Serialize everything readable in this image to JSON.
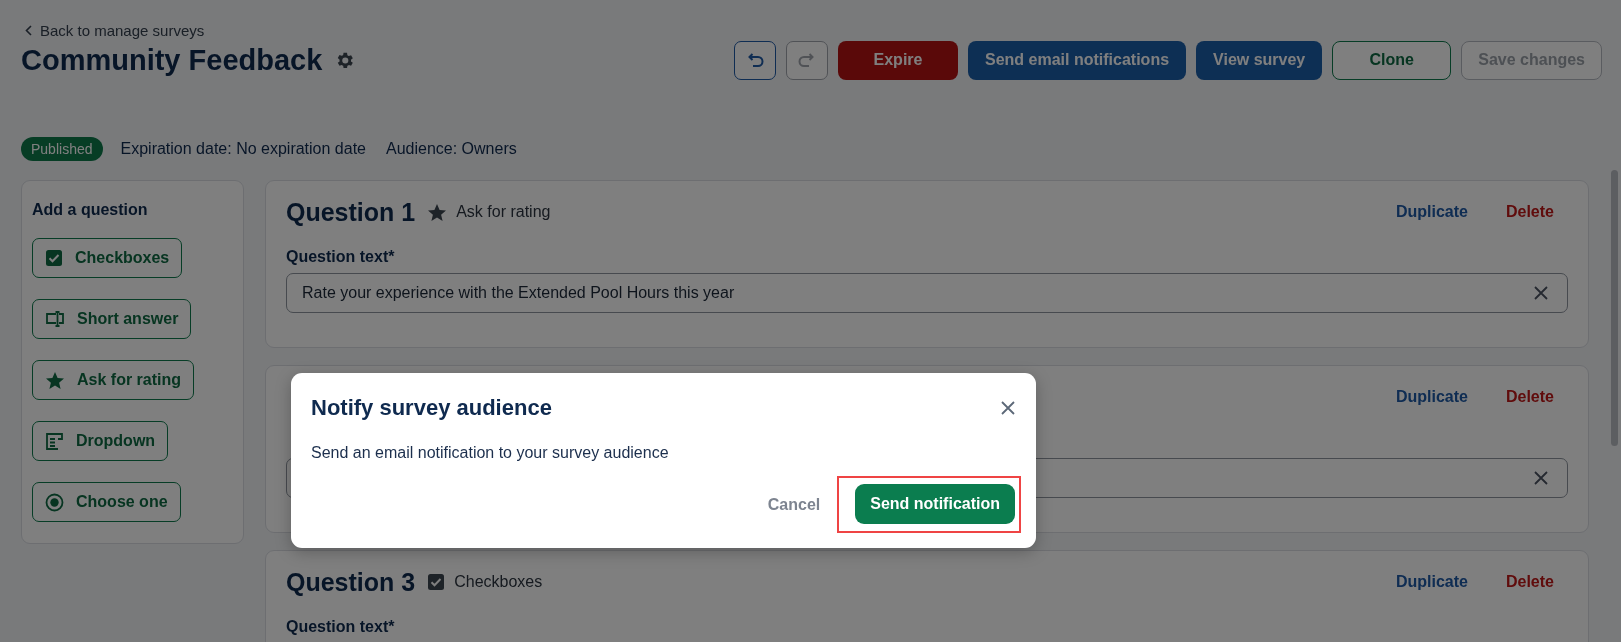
{
  "header": {
    "back_link": "Back to manage surveys",
    "title": "Community Feedback"
  },
  "toolbar": {
    "undo": {
      "disabled": false
    },
    "redo": {
      "disabled": true
    },
    "buttons": [
      {
        "label": "Expire",
        "kind": "danger",
        "disabled": false
      },
      {
        "label": "Send email notifications",
        "kind": "primary",
        "disabled": false
      },
      {
        "label": "View survey",
        "kind": "primary",
        "disabled": false
      },
      {
        "label": "Clone",
        "kind": "outline",
        "disabled": false
      },
      {
        "label": "Save changes",
        "kind": "outline",
        "disabled": true
      }
    ]
  },
  "status": {
    "badge": "Published",
    "expiration": "Expiration date: No expiration date",
    "audience": "Audience: Owners"
  },
  "sidebar": {
    "title": "Add a question",
    "items": [
      {
        "label": "Checkboxes",
        "kind": "checkboxes"
      },
      {
        "label": "Short answer",
        "kind": "short_answer"
      },
      {
        "label": "Ask for rating",
        "kind": "rating"
      },
      {
        "label": "Dropdown",
        "kind": "dropdown"
      },
      {
        "label": "Choose one",
        "kind": "choose_one"
      }
    ]
  },
  "questions": [
    {
      "title": "Question 1",
      "kind": "rating",
      "type_label": "Ask for rating",
      "actions": [
        "Duplicate",
        "Delete"
      ],
      "field_label": "Question text*",
      "field": {
        "value": "Rate your experience with the Extended Pool Hours this year",
        "clearable": true
      }
    },
    {
      "actions": [
        "Duplicate",
        "Delete"
      ],
      "field": {
        "clearable": true
      }
    },
    {
      "title": "Question 3",
      "kind": "checkboxes",
      "type_label": "Checkboxes",
      "actions": [
        "Duplicate",
        "Delete"
      ],
      "field_label": "Question text*"
    }
  ],
  "dialog": {
    "title": "Notify survey audience",
    "message": "Send an email notification to your survey audience",
    "buttons": [
      {
        "label": "Cancel",
        "kind": "text",
        "highlighted": false
      },
      {
        "label": "Send notification",
        "kind": "primary",
        "highlighted": true
      }
    ]
  }
}
